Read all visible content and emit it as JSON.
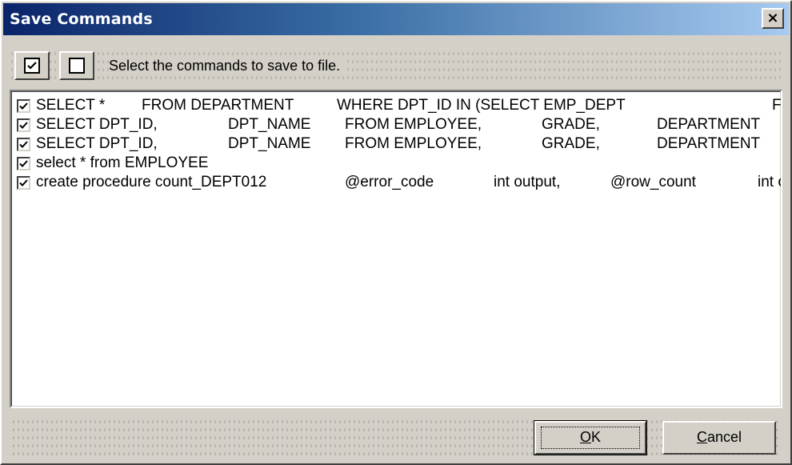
{
  "window": {
    "title": "Save Commands",
    "close_glyph": "×"
  },
  "toolbar": {
    "check_all_icon": "checkbox-checked-icon",
    "uncheck_all_icon": "checkbox-empty-icon",
    "instruction": "Select the commands to save to file."
  },
  "commands": [
    {
      "checked": true,
      "segments": [
        "SELECT *",
        "FROM DEPARTMENT",
        "WHERE DPT_ID IN (SELECT EMP_DEPT",
        "FF"
      ]
    },
    {
      "checked": true,
      "segments": [
        "SELECT DPT_ID,",
        "DPT_NAME",
        "FROM EMPLOYEE,",
        "GRADE,",
        "DEPARTMENT"
      ]
    },
    {
      "checked": true,
      "segments": [
        "SELECT DPT_ID,",
        "DPT_NAME",
        "FROM EMPLOYEE,",
        "GRADE,",
        "DEPARTMENT"
      ]
    },
    {
      "checked": true,
      "segments": [
        "select * from EMPLOYEE"
      ]
    },
    {
      "checked": true,
      "segments": [
        "create procedure count_DEPT012",
        "@error_code",
        "int output,",
        "@row_count",
        "int o"
      ]
    }
  ],
  "buttons": {
    "ok_label": "OK",
    "ok_mnemonic": "O",
    "ok_rest": "K",
    "cancel_label": "Cancel",
    "cancel_mnemonic": "C",
    "cancel_rest": "ancel"
  },
  "colors": {
    "titlebar_start": "#0a246a",
    "titlebar_end": "#a6caf0",
    "face": "#d4d0c8"
  }
}
